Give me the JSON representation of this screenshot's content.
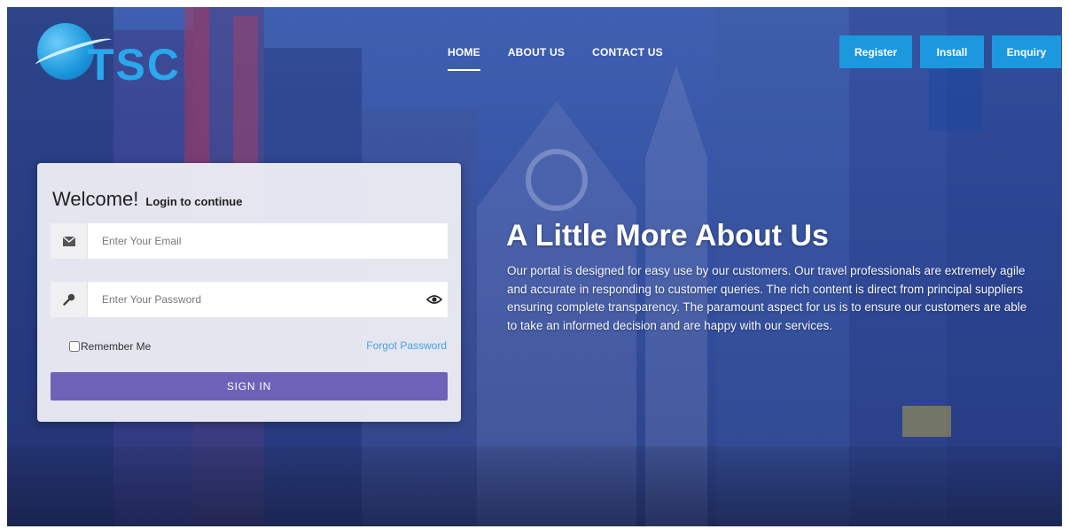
{
  "brand": {
    "logo_text": "TSC"
  },
  "nav": {
    "links": [
      {
        "label": "HOME"
      },
      {
        "label": "ABOUT US"
      },
      {
        "label": "CONTACT US"
      }
    ]
  },
  "header_buttons": {
    "register": "Register",
    "install": "Install",
    "enquiry": "Enquiry"
  },
  "login": {
    "welcome": "Welcome!",
    "subtitle": "Login to continue",
    "email_placeholder": "Enter Your Email",
    "password_placeholder": "Enter Your Password",
    "remember_label": "Remember Me",
    "forgot_label": "Forgot Password",
    "signin_label": "SIGN IN"
  },
  "about": {
    "title": "A Little More About Us",
    "body": "Our portal is designed for easy use by our customers. Our travel professionals are extremely agile and accurate in responding to customer queries. The rich content is direct from principal suppliers ensuring complete transparency. The paramount aspect for us is to ensure our customers are able to take an informed decision and are happy with our services."
  },
  "colors": {
    "accent_blue": "#1c98de",
    "signin_purple": "#6e62b8",
    "forgot_link": "#4aa0e0"
  },
  "icons": {
    "email": "envelope-icon",
    "password": "key-icon",
    "show_password": "eye-icon"
  }
}
